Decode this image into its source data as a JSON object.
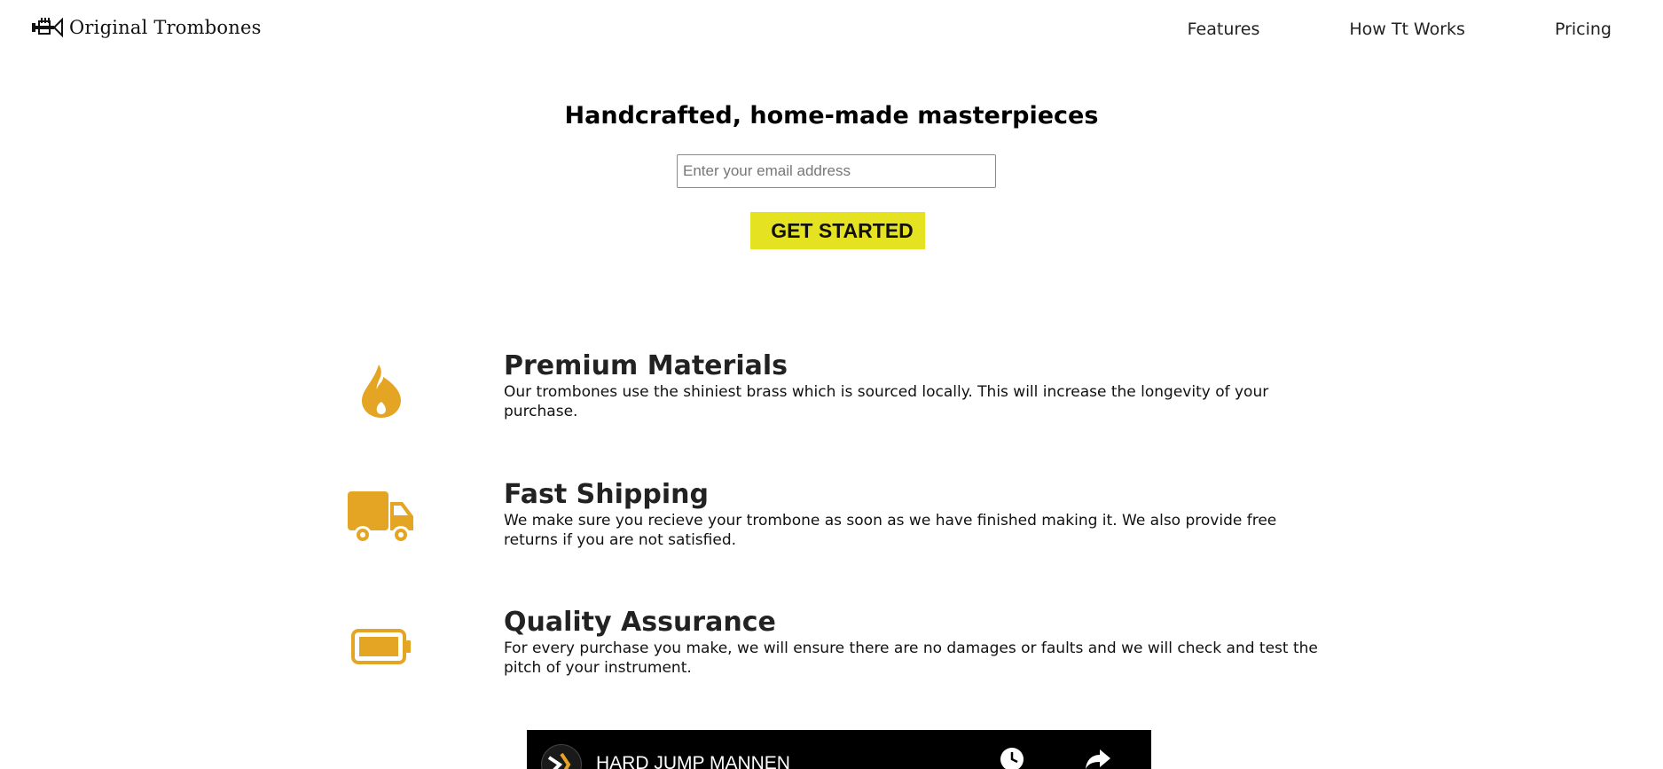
{
  "header": {
    "brand": "Original Trombones",
    "nav": [
      {
        "label": "Features"
      },
      {
        "label": "How Tt Works"
      },
      {
        "label": "Pricing"
      }
    ]
  },
  "hero": {
    "title": "Handcrafted, home-made masterpieces",
    "email_placeholder": "Enter your email address",
    "cta_label": "GET STARTED"
  },
  "features": [
    {
      "icon": "fire-icon",
      "title": "Premium Materials",
      "description": "Our trombones use the shiniest brass which is sourced locally. This will increase the longevity of your purchase."
    },
    {
      "icon": "truck-icon",
      "title": "Fast Shipping",
      "description": "We make sure you recieve your trombone as soon as we have finished making it. We also provide free returns if you are not satisfied."
    },
    {
      "icon": "battery-full-icon",
      "title": "Quality Assurance",
      "description": "For every purchase you make, we will ensure there are no damages or faults and we will check and test the pitch of your instrument."
    }
  ],
  "video": {
    "title": "HARD JUMP MANNEN"
  },
  "colors": {
    "accent_icon": "#e5a524",
    "cta_background": "#e5e222"
  }
}
